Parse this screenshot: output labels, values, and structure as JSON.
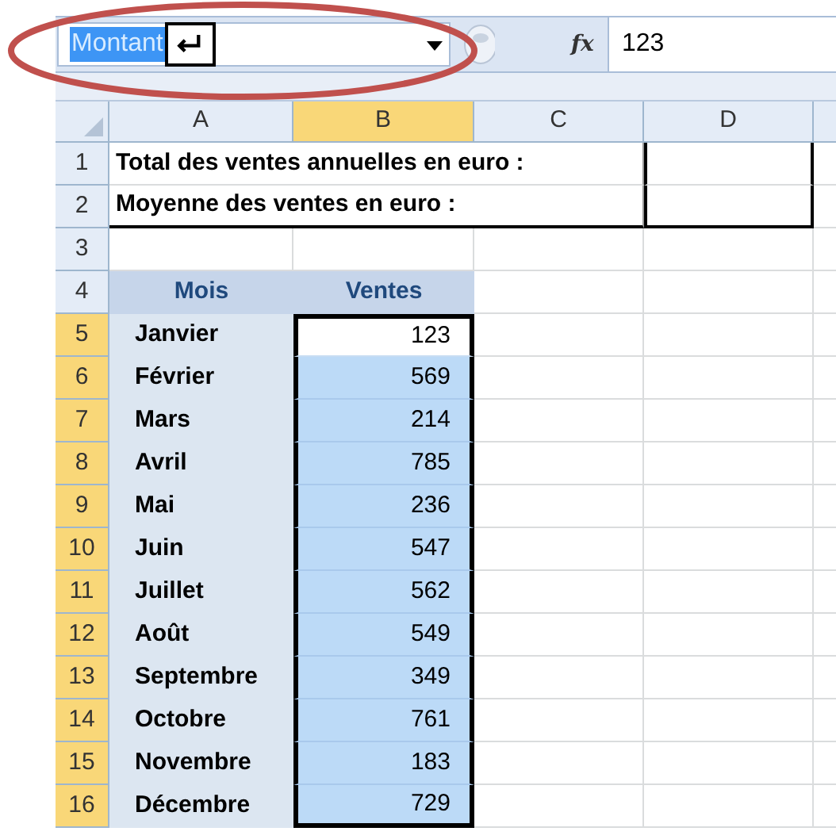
{
  "name_box": {
    "value": "Montant",
    "text_selected": true
  },
  "formula_bar": {
    "function_label": "fx",
    "value": "123"
  },
  "columns": [
    {
      "label": "A",
      "selected": false
    },
    {
      "label": "B",
      "selected": true
    },
    {
      "label": "C",
      "selected": false
    },
    {
      "label": "D",
      "selected": false
    }
  ],
  "rows": [
    {
      "number": "1",
      "selected": false,
      "kind": "summary",
      "label": "Total des ventes annuelles en euro :"
    },
    {
      "number": "2",
      "selected": false,
      "kind": "summary",
      "label": "Moyenne des ventes en euro :"
    },
    {
      "number": "3",
      "selected": false,
      "kind": "blank"
    },
    {
      "number": "4",
      "selected": false,
      "kind": "header",
      "cells": [
        "Mois",
        "Ventes"
      ]
    },
    {
      "number": "5",
      "selected": true,
      "kind": "data",
      "month": "Janvier",
      "value": "123",
      "active": true
    },
    {
      "number": "6",
      "selected": true,
      "kind": "data",
      "month": "Février",
      "value": "569",
      "active": false
    },
    {
      "number": "7",
      "selected": true,
      "kind": "data",
      "month": "Mars",
      "value": "214",
      "active": false
    },
    {
      "number": "8",
      "selected": true,
      "kind": "data",
      "month": "Avril",
      "value": "785",
      "active": false
    },
    {
      "number": "9",
      "selected": true,
      "kind": "data",
      "month": "Mai",
      "value": "236",
      "active": false
    },
    {
      "number": "10",
      "selected": true,
      "kind": "data",
      "month": "Juin",
      "value": "547",
      "active": false
    },
    {
      "number": "11",
      "selected": true,
      "kind": "data",
      "month": "Juillet",
      "value": "562",
      "active": false
    },
    {
      "number": "12",
      "selected": true,
      "kind": "data",
      "month": "Août",
      "value": "549",
      "active": false
    },
    {
      "number": "13",
      "selected": true,
      "kind": "data",
      "month": "Septembre",
      "value": "349",
      "active": false
    },
    {
      "number": "14",
      "selected": true,
      "kind": "data",
      "month": "Octobre",
      "value": "761",
      "active": false
    },
    {
      "number": "15",
      "selected": true,
      "kind": "data",
      "month": "Novembre",
      "value": "183",
      "active": false
    },
    {
      "number": "16",
      "selected": true,
      "kind": "data",
      "month": "Décembre",
      "value": "729",
      "active": false
    }
  ]
}
